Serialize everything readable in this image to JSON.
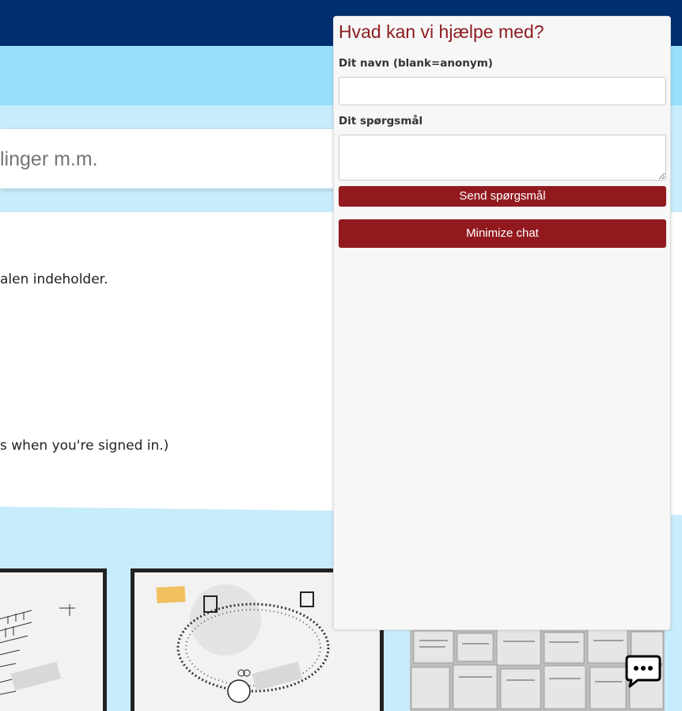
{
  "search": {
    "placeholder_text": "linger m.m."
  },
  "content": {
    "line1": "alen indeholder.",
    "line2": "s when you're signed in.)"
  },
  "chat": {
    "title": "Hvad kan vi hjælpe med?",
    "name_label": "Dit navn (blank=anonym)",
    "name_value": "",
    "question_label": "Dit spørgsmål",
    "question_value": "",
    "send_button": "Send spørgsmål",
    "minimize_button": "Minimize chat"
  },
  "icons": {
    "chat_launcher": "speech-bubble-icon"
  },
  "colors": {
    "top_bar": "#002f70",
    "light_band": "#98e0fa",
    "pale_band": "#c7ecfb",
    "chat_accent": "#921a1f",
    "chat_title": "#8d1b1f"
  }
}
